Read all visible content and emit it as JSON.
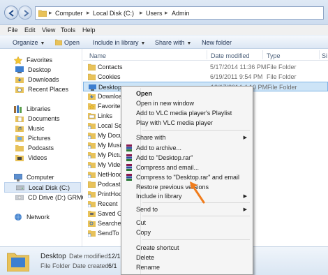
{
  "address": {
    "crumbs": [
      "Computer",
      "Local Disk (C:)",
      "Users",
      "Admin"
    ]
  },
  "menubar": {
    "items": [
      "File",
      "Edit",
      "View",
      "Tools",
      "Help"
    ]
  },
  "toolbar": {
    "organize": "Organize",
    "open": "Open",
    "include_in_library": "Include in library",
    "share_with": "Share with",
    "new_folder": "New folder"
  },
  "nav": {
    "favorites": "Favorites",
    "desktop": "Desktop",
    "downloads": "Downloads",
    "recent_places": "Recent Places",
    "libraries": "Libraries",
    "documents": "Documents",
    "music": "Music",
    "pictures": "Pictures",
    "podcasts": "Podcasts",
    "videos": "Videos",
    "computer": "Computer",
    "local_disk": "Local Disk (C:)",
    "cd_drive": "CD Drive (D:) GRMC",
    "network": "Network"
  },
  "columns": {
    "name": "Name",
    "date": "Date modified",
    "type": "Type",
    "size": "Si"
  },
  "files": [
    {
      "name": "Contacts",
      "date": "5/17/2014 11:36 PM",
      "type": "File Folder"
    },
    {
      "name": "Cookies",
      "date": "6/19/2011 9:54 PM",
      "type": "File Folder"
    },
    {
      "name": "Desktop",
      "date": "12/17/2014 4:10 PM",
      "type": "File Folder"
    },
    {
      "name": "Download",
      "date": "",
      "type": ""
    },
    {
      "name": "Favorites",
      "date": "",
      "type": ""
    },
    {
      "name": "Links",
      "date": "",
      "type": ""
    },
    {
      "name": "Local Set",
      "date": "",
      "type": ""
    },
    {
      "name": "My Docu",
      "date": "",
      "type": ""
    },
    {
      "name": "My Music",
      "date": "",
      "type": ""
    },
    {
      "name": "My Pictur",
      "date": "",
      "type": ""
    },
    {
      "name": "My Video",
      "date": "",
      "type": ""
    },
    {
      "name": "NetHood",
      "date": "",
      "type": ""
    },
    {
      "name": "Podcasts",
      "date": "",
      "type": ""
    },
    {
      "name": "PrintHoo",
      "date": "",
      "type": ""
    },
    {
      "name": "Recent",
      "date": "",
      "type": ""
    },
    {
      "name": "Saved Ga",
      "date": "",
      "type": ""
    },
    {
      "name": "Searches",
      "date": "",
      "type": ""
    },
    {
      "name": "SendTo",
      "date": "",
      "type": ""
    }
  ],
  "details": {
    "name": "Desktop",
    "type": "File Folder",
    "modified_label": "Date modified:",
    "modified_value": "12/1",
    "created_label": "Date created:",
    "created_value": "6/1"
  },
  "context_menu": {
    "open": "Open",
    "open_new_window": "Open in new window",
    "add_vlc_playlist": "Add to VLC media player's Playlist",
    "play_vlc": "Play with VLC media player",
    "share_with": "Share with",
    "add_archive": "Add to archive...",
    "add_desktop_rar": "Add to \"Desktop.rar\"",
    "compress_email": "Compress and email...",
    "compress_desktop_rar_email": "Compress to \"Desktop.rar\" and email",
    "restore_previous": "Restore previous versions",
    "include_library": "Include in library",
    "send_to": "Send to",
    "cut": "Cut",
    "copy": "Copy",
    "create_shortcut": "Create shortcut",
    "delete": "Delete",
    "rename": "Rename"
  },
  "colors": {
    "accent_arrow": "#f07c1c",
    "selection": "#cde4f7",
    "folder": "#e8c25a"
  }
}
